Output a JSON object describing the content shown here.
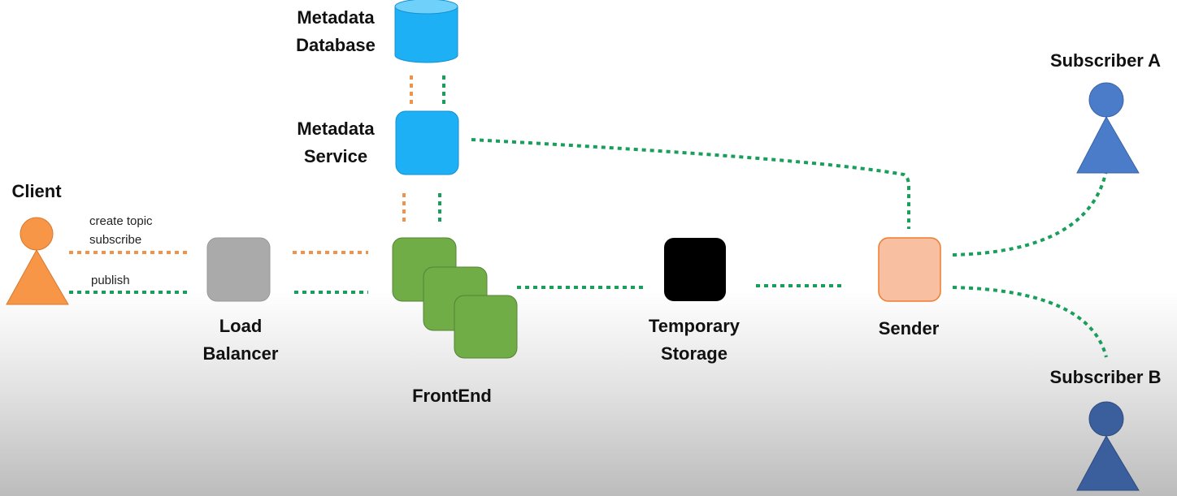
{
  "nodes": {
    "client": {
      "label": "Client",
      "color": "#f79646"
    },
    "load_balancer": {
      "label_line1": "Load",
      "label_line2": "Balancer",
      "color": "#aaaaaa"
    },
    "frontend": {
      "label": "FrontEnd",
      "color": "#70ad47"
    },
    "metadata_service": {
      "label_line1": "Metadata",
      "label_line2": "Service",
      "color": "#1eb0f5"
    },
    "metadata_database": {
      "label_line1": "Metadata",
      "label_line2": "Database",
      "color": "#1eb0f5"
    },
    "temporary_storage": {
      "label_line1": "Temporary",
      "label_line2": "Storage",
      "color": "#000000"
    },
    "sender": {
      "label": "Sender",
      "color": "#f8bfa0"
    },
    "subscriber_a": {
      "label": "Subscriber A",
      "color": "#4a7cc9"
    },
    "subscriber_b": {
      "label": "Subscriber B",
      "color": "#3a5f9c"
    }
  },
  "edges": {
    "create_topic_label": "create topic",
    "subscribe_label": "subscribe",
    "publish_label": "publish",
    "orange_color": "#f0924a",
    "green_color": "#1a9e5c"
  }
}
